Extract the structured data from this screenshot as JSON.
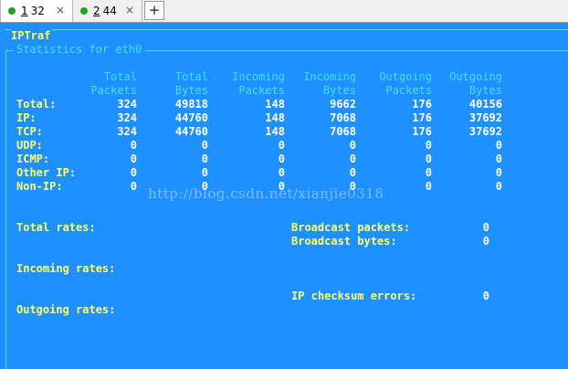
{
  "tabs": [
    {
      "num": "1",
      "label": "32",
      "close": "×",
      "status_color": "#1fa51f",
      "active": true
    },
    {
      "num": "2",
      "label": "44",
      "close": "×",
      "status_color": "#1fa51f",
      "active": false
    }
  ],
  "add_tab_label": "+",
  "app_title": "IPTraf",
  "frame_title": "Statistics for eth0",
  "columns": [
    {
      "line1": "Total",
      "line2": "Packets"
    },
    {
      "line1": "Total",
      "line2": "Bytes"
    },
    {
      "line1": "Incoming",
      "line2": "Packets"
    },
    {
      "line1": "Incoming",
      "line2": "Bytes"
    },
    {
      "line1": "Outgoing",
      "line2": "Packets"
    },
    {
      "line1": "Outgoing",
      "line2": "Bytes"
    }
  ],
  "rows": [
    {
      "label": "Total:",
      "values": [
        "324",
        "49818",
        "148",
        "9662",
        "176",
        "40156"
      ]
    },
    {
      "label": "IP:",
      "values": [
        "324",
        "44760",
        "148",
        "7068",
        "176",
        "37692"
      ]
    },
    {
      "label": "TCP:",
      "values": [
        "324",
        "44760",
        "148",
        "7068",
        "176",
        "37692"
      ]
    },
    {
      "label": "UDP:",
      "values": [
        "0",
        "0",
        "0",
        "0",
        "0",
        "0"
      ]
    },
    {
      "label": "ICMP:",
      "values": [
        "0",
        "0",
        "0",
        "0",
        "0",
        "0"
      ]
    },
    {
      "label": "Other IP:",
      "values": [
        "0",
        "0",
        "0",
        "0",
        "0",
        "0"
      ]
    },
    {
      "label": "Non-IP:",
      "values": [
        "0",
        "0",
        "0",
        "0",
        "0",
        "0"
      ]
    }
  ],
  "watermark": "http://blog.csdn.net/xianjie0318",
  "rates": {
    "total_label": "Total rates:",
    "incoming_label": "Incoming rates:",
    "outgoing_label": "Outgoing rates:"
  },
  "extra_stats": [
    {
      "label": "Broadcast packets:",
      "value": "0"
    },
    {
      "label": "Broadcast bytes:",
      "value": "0"
    },
    {
      "label": "IP checksum errors:",
      "value": "0"
    }
  ],
  "colors": {
    "background": "#1e90ff",
    "border": "#45e0ff",
    "label": "#ffff66",
    "value": "#ffffff"
  }
}
